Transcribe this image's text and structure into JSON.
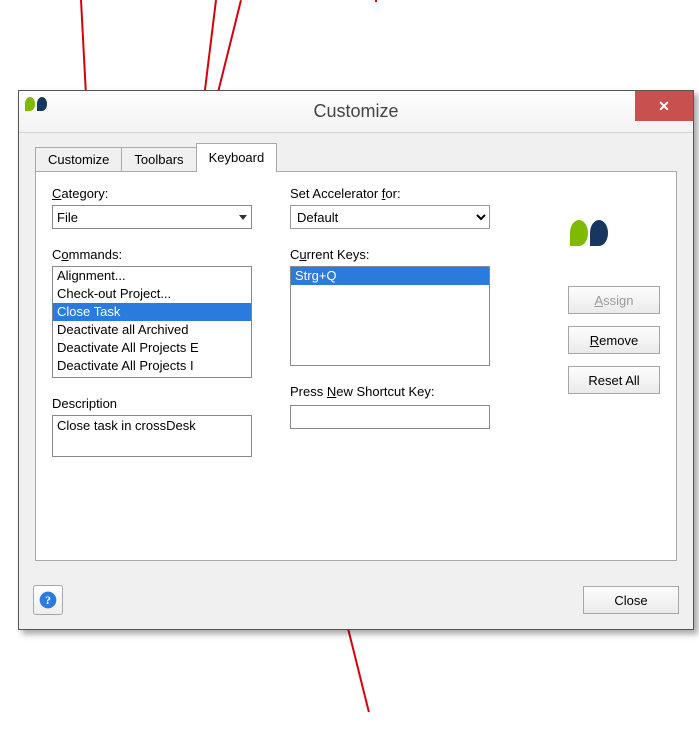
{
  "window": {
    "title": "Customize",
    "tabs": [
      "Customize",
      "Toolbars",
      "Keyboard"
    ],
    "active_tab": 2
  },
  "left": {
    "category_label": "Category:",
    "category_value": "File",
    "commands_label": "Commands:",
    "commands": [
      "Alignment...",
      "Check-out Project...",
      "Close Task",
      "Deactivate all Archived",
      "Deactivate All Projects E",
      "Deactivate All Projects I"
    ],
    "selected_command_index": 2,
    "description_label": "Description",
    "description_text": "Close task in crossDesk"
  },
  "mid": {
    "accel_label": "Set Accelerator for:",
    "accel_value": "Default",
    "current_keys_label": "Current Keys:",
    "current_keys": [
      "Strg+Q"
    ],
    "press_new_label": "Press New Shortcut Key:",
    "press_new_value": ""
  },
  "right": {
    "assign_label": "Assign",
    "remove_label": "Remove",
    "reset_label": "Reset All"
  },
  "footer": {
    "close_label": "Close"
  }
}
